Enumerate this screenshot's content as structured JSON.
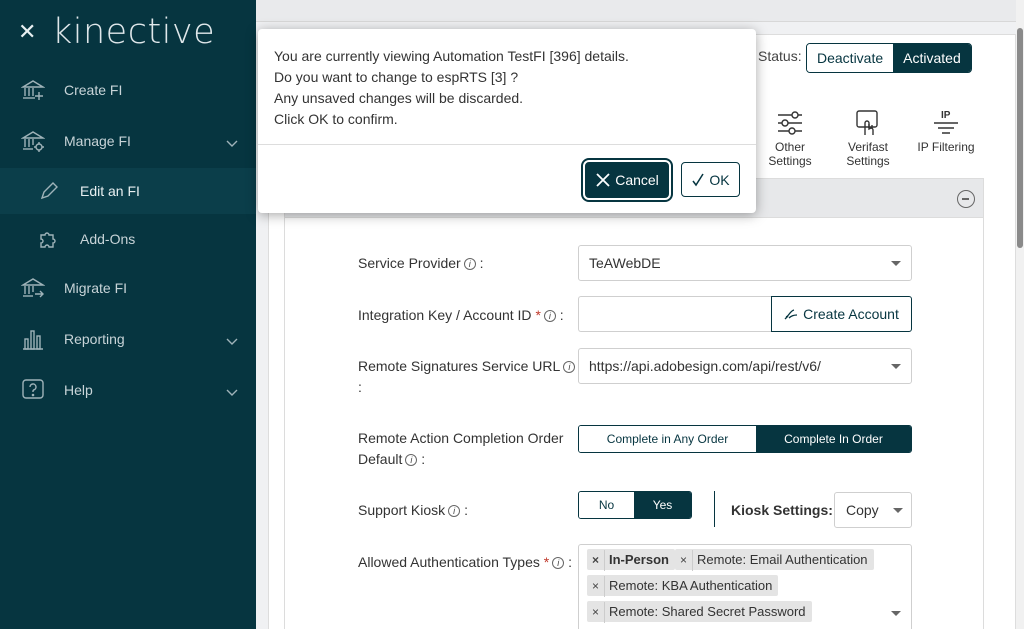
{
  "sidebar": {
    "logo": "kinective",
    "items": [
      {
        "label": "Create FI"
      },
      {
        "label": "Manage FI"
      },
      {
        "label": "Edit an FI"
      },
      {
        "label": "Add-Ons"
      },
      {
        "label": "Migrate FI"
      },
      {
        "label": "Reporting"
      },
      {
        "label": "Help"
      }
    ]
  },
  "status": {
    "label": "Status:",
    "deactivate": "Deactivate",
    "activated": "Activated"
  },
  "tabs": [
    {
      "line1": "Other",
      "line2": "Settings"
    },
    {
      "line1": "Verifast",
      "line2": "Settings"
    },
    {
      "line1": "IP Filtering",
      "line2": ""
    }
  ],
  "form": {
    "service_provider_label": "Service Provider",
    "service_provider_value": "TeAWebDE",
    "integration_key_label": "Integration Key / Account ID",
    "integration_key_value": "",
    "create_account_label": "Create Account",
    "remote_sig_url_label": "Remote Signatures Service URL",
    "remote_sig_url_value": "https://api.adobesign.com/api/rest/v6/",
    "completion_order_label_1": "Remote Action Completion Order",
    "completion_order_label_2": "Default",
    "completion_any": "Complete in Any Order",
    "completion_in_order": "Complete In Order",
    "support_kiosk_label": "Support Kiosk",
    "kiosk_no": "No",
    "kiosk_yes": "Yes",
    "kiosk_settings_label": "Kiosk Settings:",
    "kiosk_settings_value": "Copy",
    "auth_types_label": "Allowed Authentication Types",
    "auth_types": [
      "In-Person",
      "Remote: Email Authentication",
      "Remote: KBA Authentication",
      "Remote: Shared Secret Password"
    ],
    "colon": ":"
  },
  "dialog": {
    "line1": "You are currently viewing Automation TestFI [396] details.",
    "line2": "Do you want to change to espRTS [3] ?",
    "line3": "Any unsaved changes will be discarded.",
    "line4": "Click OK to confirm.",
    "cancel_label": "Cancel",
    "ok_label": "OK"
  }
}
